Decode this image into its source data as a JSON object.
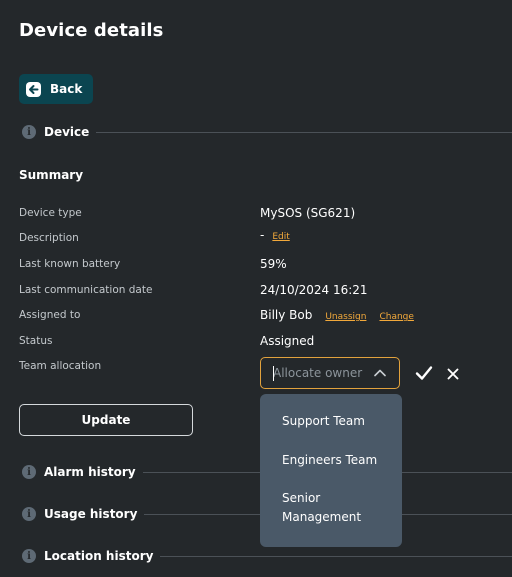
{
  "page": {
    "title": "Device details"
  },
  "back_button": {
    "label": "Back"
  },
  "sections": {
    "device": "Device",
    "alarm_history": "Alarm history",
    "usage_history": "Usage history",
    "location_history": "Location history"
  },
  "summary": {
    "heading": "Summary",
    "rows": [
      {
        "label": "Device type",
        "value": "MySOS (SG621)"
      },
      {
        "label": "Description",
        "value": "-"
      },
      {
        "label": "Last known battery",
        "value": "59%"
      },
      {
        "label": "Last communication date",
        "value": "24/10/2024 16:21"
      },
      {
        "label": "Assigned to",
        "value": "Billy Bob"
      },
      {
        "label": "Status",
        "value": "Assigned"
      },
      {
        "label": "Team allocation",
        "value": ""
      }
    ],
    "links": {
      "edit": "Edit",
      "unassign": "Unassign",
      "change": "Change"
    }
  },
  "team_select": {
    "placeholder": "Allocate owner",
    "options": [
      "Support Team",
      "Engineers Team",
      "Senior Management"
    ]
  },
  "update_button": {
    "label": "Update"
  },
  "colors": {
    "background": "#24282b",
    "back_button": "#0b4550",
    "accent": "#e2a23d",
    "link": "#f2a93b",
    "dropdown": "#4a5968"
  },
  "icons": {
    "back": "arrow-left-icon",
    "info": "info-icon",
    "chevron": "chevron-up-icon",
    "confirm": "check-icon",
    "cancel": "close-icon"
  }
}
